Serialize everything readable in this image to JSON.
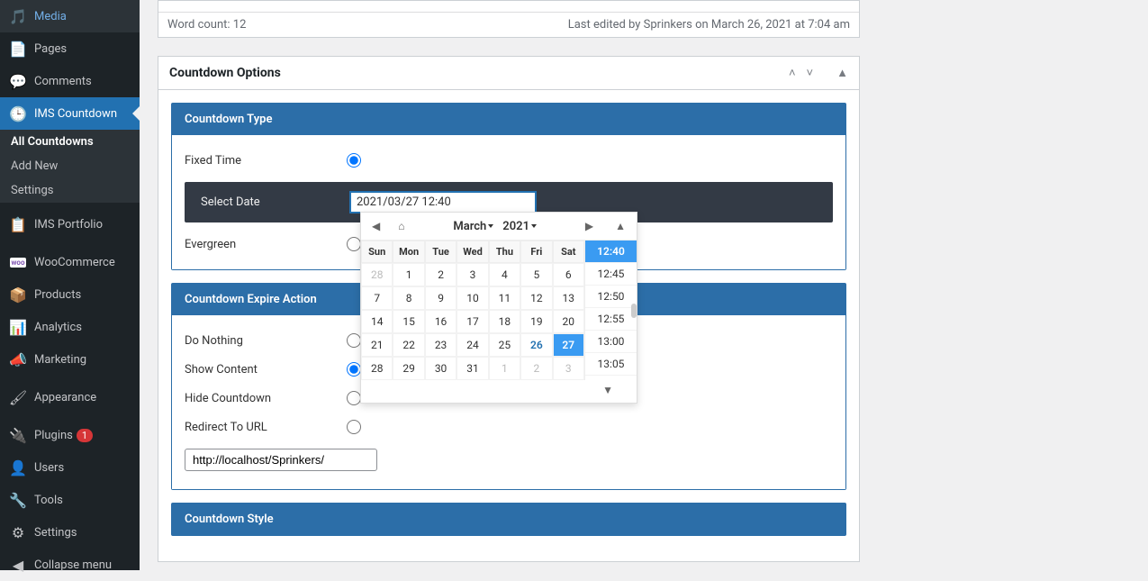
{
  "sidebar": {
    "items": [
      {
        "label": "Media",
        "icon": "media"
      },
      {
        "label": "Pages",
        "icon": "pages"
      },
      {
        "label": "Comments",
        "icon": "comments"
      },
      {
        "label": "IMS Countdown",
        "icon": "clock",
        "active": true
      },
      {
        "label": "IMS Portfolio",
        "icon": "portfolio"
      },
      {
        "label": "WooCommerce",
        "icon": "woo"
      },
      {
        "label": "Products",
        "icon": "products"
      },
      {
        "label": "Analytics",
        "icon": "analytics"
      },
      {
        "label": "Marketing",
        "icon": "marketing"
      },
      {
        "label": "Appearance",
        "icon": "appearance"
      },
      {
        "label": "Plugins",
        "icon": "plugins",
        "badge": "1"
      },
      {
        "label": "Users",
        "icon": "users"
      },
      {
        "label": "Tools",
        "icon": "tools"
      },
      {
        "label": "Settings",
        "icon": "settings"
      },
      {
        "label": "Collapse menu",
        "icon": "collapse"
      }
    ],
    "subitems": [
      {
        "label": "All Countdowns",
        "active": true
      },
      {
        "label": "Add New"
      },
      {
        "label": "Settings"
      }
    ]
  },
  "editor": {
    "word_count": "Word count: 12",
    "last_edited": "Last edited by Sprinkers on March 26, 2021 at 7:04 am"
  },
  "metabox": {
    "title": "Countdown Options"
  },
  "countdown_type": {
    "header": "Countdown Type",
    "fixed_time": "Fixed Time",
    "select_date": "Select Date",
    "date_value": "2021/03/27 12:40",
    "evergreen": "Evergreen"
  },
  "expire_action": {
    "header": "Countdown Expire Action",
    "do_nothing": "Do Nothing",
    "show_content": "Show Content",
    "hide_countdown": "Hide Countdown",
    "redirect_to_url": "Redirect To URL",
    "url_value": "http://localhost/Sprinkers/"
  },
  "countdown_style": {
    "header": "Countdown Style"
  },
  "datepicker": {
    "month": "March",
    "year": "2021",
    "days_header": [
      "Sun",
      "Mon",
      "Tue",
      "Wed",
      "Thu",
      "Fri",
      "Sat"
    ],
    "weeks": [
      [
        {
          "d": "28",
          "o": true
        },
        {
          "d": "1"
        },
        {
          "d": "2"
        },
        {
          "d": "3"
        },
        {
          "d": "4"
        },
        {
          "d": "5"
        },
        {
          "d": "6"
        }
      ],
      [
        {
          "d": "7"
        },
        {
          "d": "8"
        },
        {
          "d": "9"
        },
        {
          "d": "10"
        },
        {
          "d": "11"
        },
        {
          "d": "12"
        },
        {
          "d": "13"
        }
      ],
      [
        {
          "d": "14"
        },
        {
          "d": "15"
        },
        {
          "d": "16"
        },
        {
          "d": "17"
        },
        {
          "d": "18"
        },
        {
          "d": "19"
        },
        {
          "d": "20"
        }
      ],
      [
        {
          "d": "21"
        },
        {
          "d": "22"
        },
        {
          "d": "23"
        },
        {
          "d": "24"
        },
        {
          "d": "25"
        },
        {
          "d": "26",
          "t": true
        },
        {
          "d": "27",
          "s": true
        }
      ],
      [
        {
          "d": "28"
        },
        {
          "d": "29"
        },
        {
          "d": "30"
        },
        {
          "d": "31"
        },
        {
          "d": "1",
          "o": true
        },
        {
          "d": "2",
          "o": true
        },
        {
          "d": "3",
          "o": true
        }
      ]
    ],
    "times": [
      "12:40",
      "12:45",
      "12:50",
      "12:55",
      "13:00",
      "13:05"
    ],
    "selected_time": "12:40"
  }
}
